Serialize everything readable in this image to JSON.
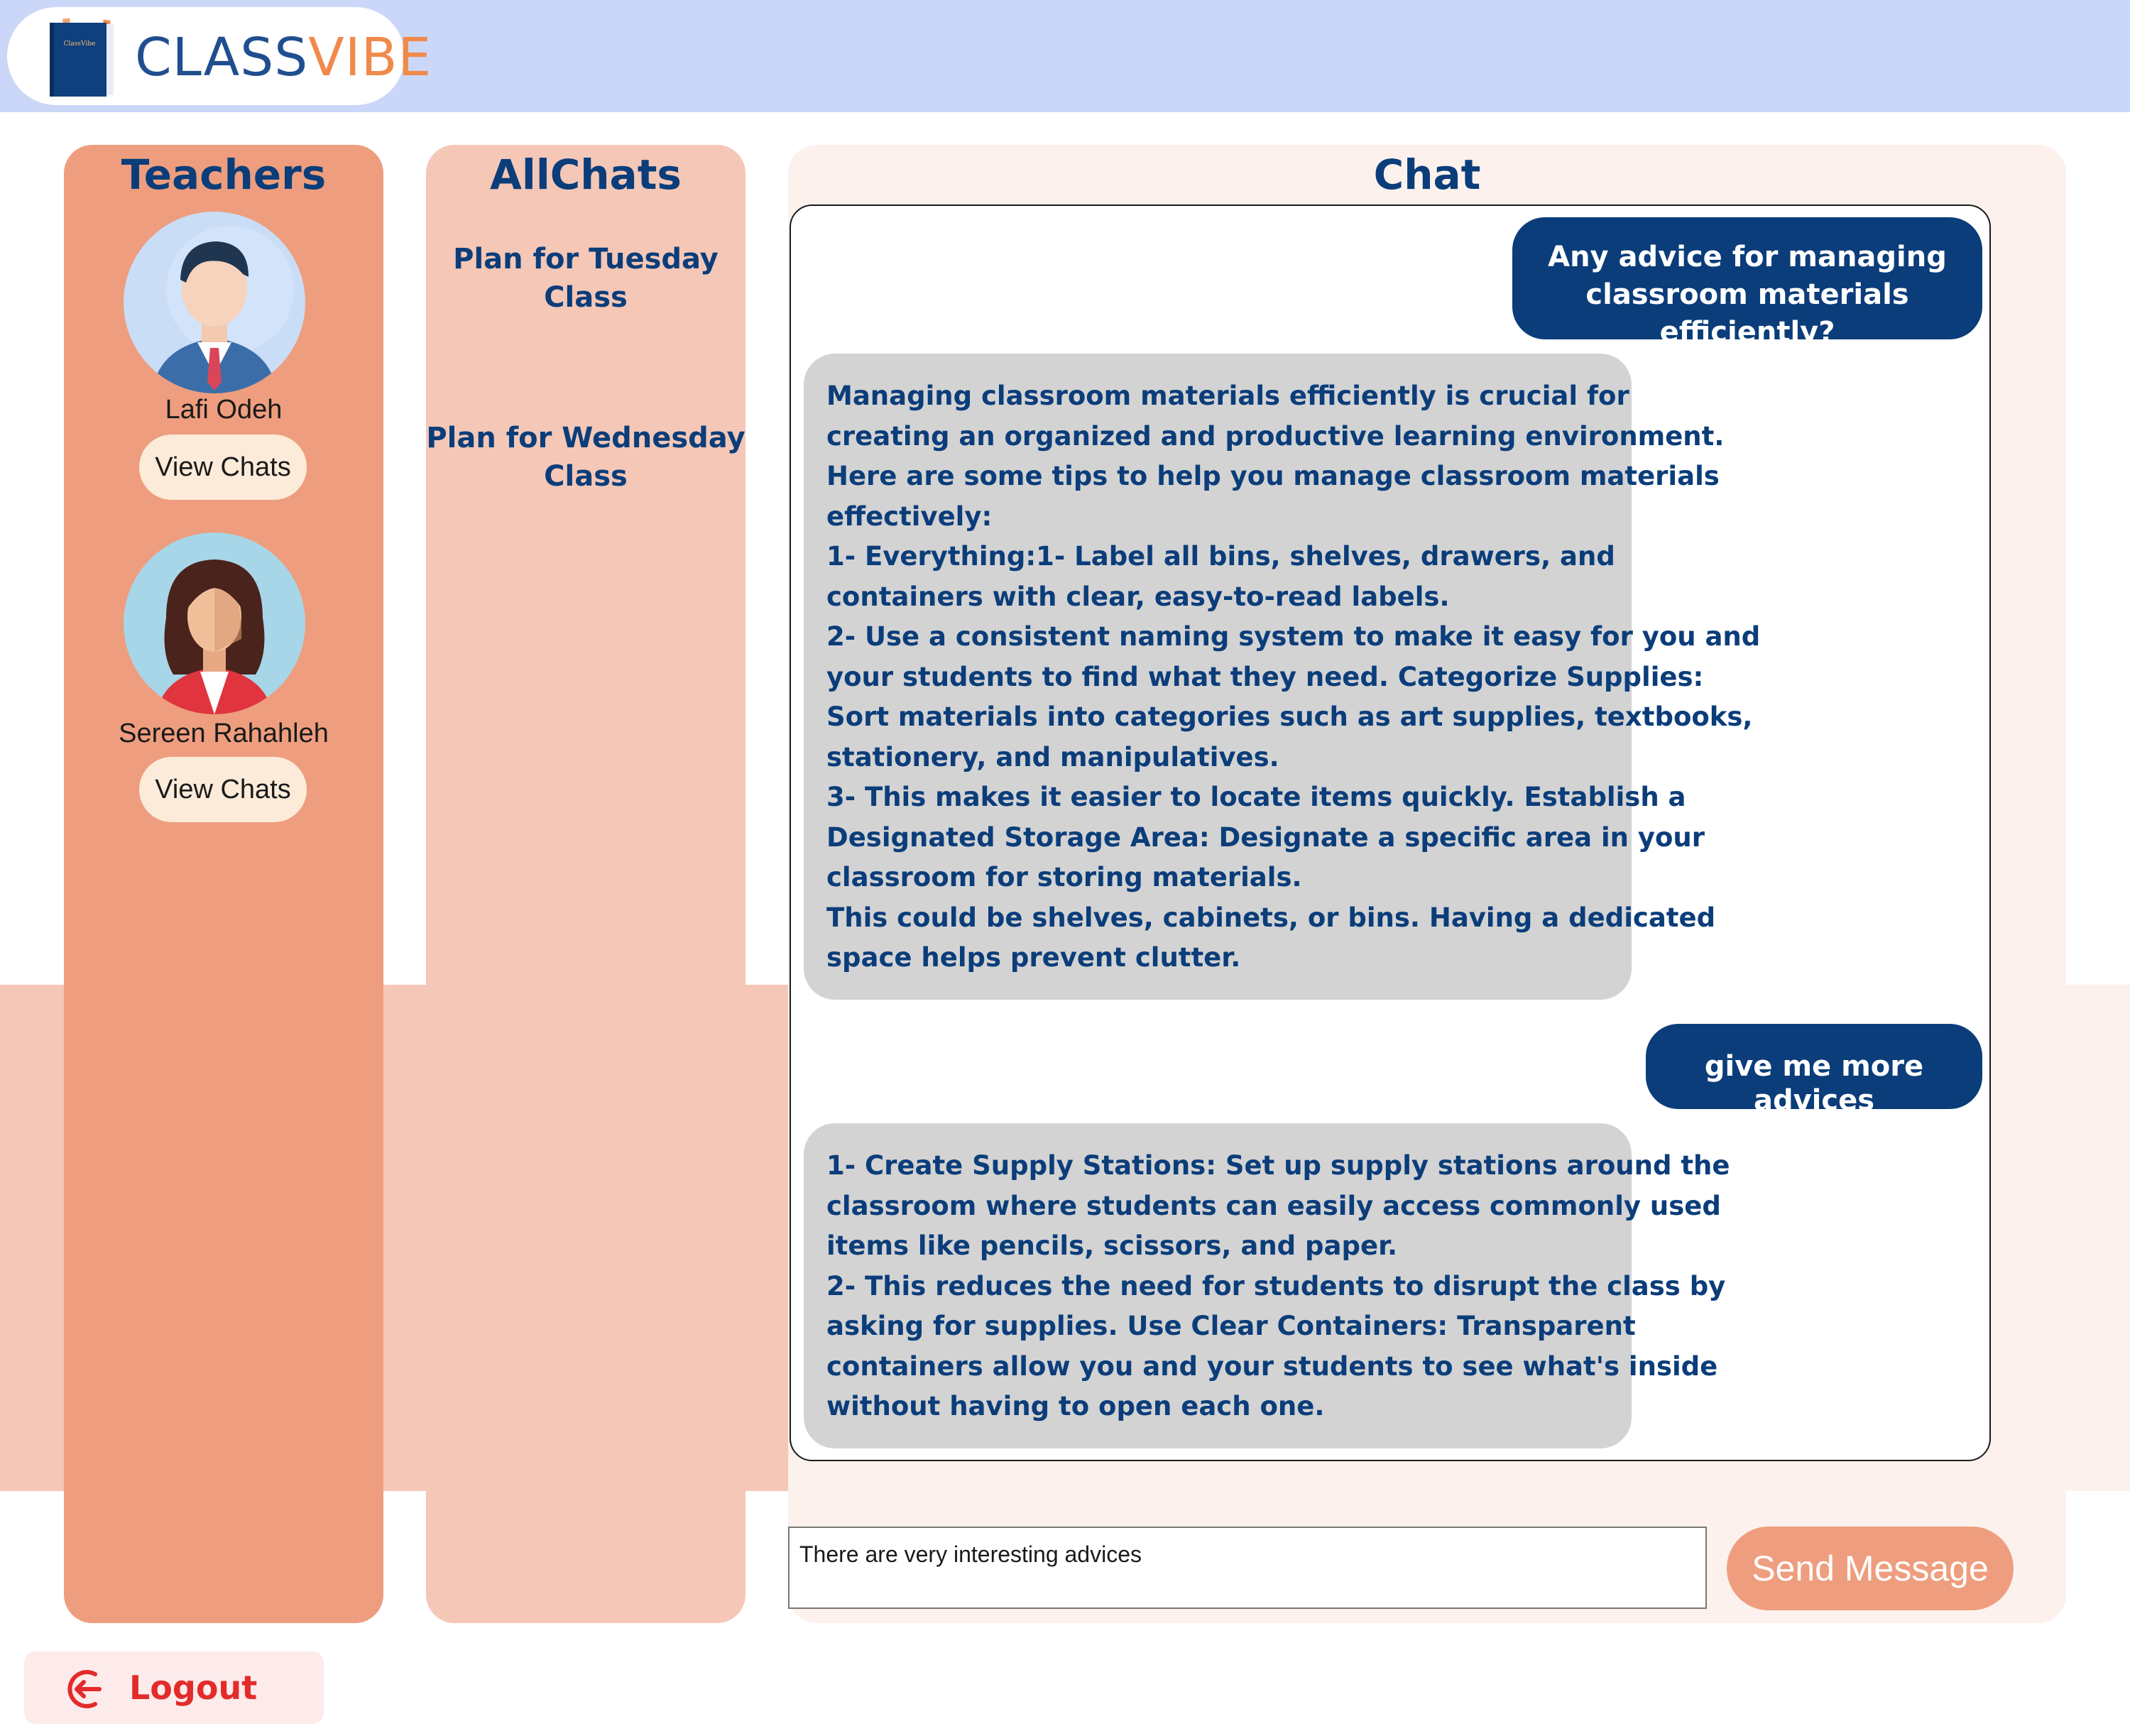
{
  "brand": {
    "name_part1": "CLASS",
    "name_part2": "VIBE",
    "book_label": "ClassVibe"
  },
  "teachers": {
    "title": "Teachers",
    "items": [
      {
        "name": "Lafi Odeh",
        "button": "View Chats",
        "avatar_icon": "male-teacher-avatar"
      },
      {
        "name": "Sereen Rahahleh",
        "button": "View Chats",
        "avatar_icon": "female-teacher-avatar"
      }
    ]
  },
  "allchats": {
    "title": "AllChats",
    "items": [
      {
        "lines": [
          "Plan for Tuesday",
          "Class"
        ]
      },
      {
        "lines": [
          "Plan for Wednesday",
          "Class"
        ]
      }
    ]
  },
  "chat": {
    "title": "Chat",
    "messages": [
      {
        "role": "user",
        "lines": [
          "Any advice for managing",
          "classroom materials efficiently?"
        ]
      },
      {
        "role": "bot",
        "lines": [
          "Managing classroom materials efficiently is crucial for",
          "creating an organized and productive learning environment.",
          "Here are some tips to help you manage classroom materials",
          "effectively:",
          "1- Everything:1- Label all bins, shelves, drawers, and",
          "containers with clear, easy-to-read labels.",
          "2- Use a consistent naming system to make it easy for you and",
          "your students to find what they need. Categorize Supplies:",
          "Sort materials into categories such as art supplies, textbooks,",
          "stationery, and manipulatives.",
          "3- This makes it easier to locate items quickly. Establish a",
          "Designated Storage Area: Designate a specific area in your",
          "classroom for storing materials.",
          "This could be shelves, cabinets, or bins. Having a dedicated",
          "space helps prevent clutter."
        ]
      },
      {
        "role": "user",
        "lines": [
          "give me more advices"
        ]
      },
      {
        "role": "bot",
        "lines": [
          "1- Create Supply Stations: Set up supply stations around the",
          "classroom where students can easily access commonly used",
          "items like pencils, scissors, and paper.",
          "2- This reduces the need for students to disrupt the class by",
          "asking for supplies. Use Clear Containers: Transparent",
          "containers allow you and your students to see what's inside",
          "without having to open each one."
        ]
      }
    ],
    "input_value": "There are very interesting advices",
    "send_label": "Send Message"
  },
  "logout": {
    "label": "Logout",
    "icon": "logout-icon"
  },
  "colors": {
    "topbar": "#cbd7f8",
    "teachers_panel": "#ee9e7e",
    "allchats_panel": "#f4c7b7",
    "chat_panel": "#fcf1ec",
    "navy": "#0b3d7a",
    "bot_bubble": "#d3d3d3",
    "logout_red": "#e32b2b"
  }
}
